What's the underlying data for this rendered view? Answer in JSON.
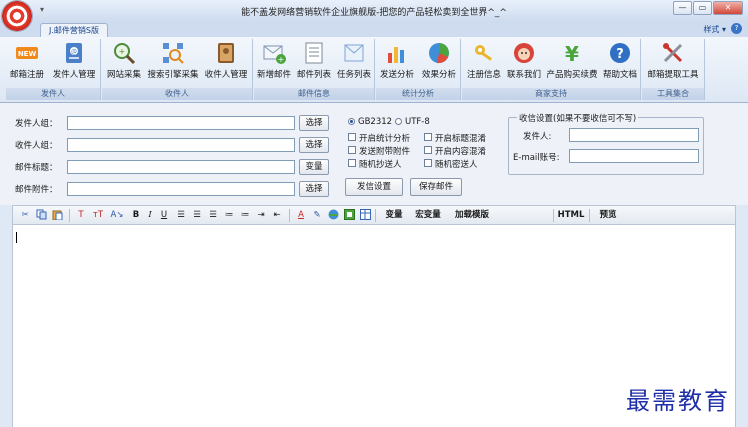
{
  "window": {
    "title": "能不盖发网络营销软件企业旗舰版-把您的产品轻松卖到全世界^_^",
    "quick_access": "▾",
    "controls": {
      "minimize": "—",
      "restore": "▭",
      "close": "✕"
    }
  },
  "tabbar": {
    "active_tab": "J.邮件营销S版",
    "style_menu": "样式 ▾",
    "help": "?"
  },
  "ribbon": {
    "groups": [
      {
        "label": "发件人",
        "buttons": [
          "邮箱注册",
          "发件人管理"
        ]
      },
      {
        "label": "收件人",
        "buttons": [
          "网站采集",
          "搜索引擎采集",
          "收件人管理"
        ]
      },
      {
        "label": "邮件信息",
        "buttons": [
          "新增邮件",
          "邮件列表",
          "任务列表"
        ]
      },
      {
        "label": "统计分析",
        "buttons": [
          "发送分析",
          "效果分析"
        ]
      },
      {
        "label": "商家支持",
        "buttons": [
          "注册信息",
          "联系我们",
          "产品购买续费",
          "帮助文档"
        ]
      },
      {
        "label": "工具集合",
        "buttons": [
          "邮箱提取工具"
        ]
      }
    ],
    "icon_badges": {
      "new": "NEW",
      "yen": "¥",
      "help": "?"
    }
  },
  "form": {
    "labels": {
      "sender_group": "发件人组：",
      "recipient_group": "收件人组：",
      "subject": "邮件标题：",
      "attachment": "邮件附件："
    },
    "values": {
      "sender_group": "",
      "recipient_group": "",
      "subject": "",
      "attachment": ""
    },
    "buttons": {
      "select": "选择",
      "variable": "变量",
      "send_settings": "发信设置",
      "save_mail": "保存邮件"
    },
    "encoding": {
      "selected": "GB2312",
      "options": [
        "GB2312",
        "UTF-8"
      ]
    },
    "options": [
      "开启统计分析",
      "发送附带附件",
      "随机抄送人",
      "开启标题混淆",
      "开启内容混淆",
      "随机密送人"
    ],
    "receive": {
      "legend": "收信设置(如果不要收信可不写)",
      "sender_label": "发件人:",
      "email_label": "E-mail账号:",
      "sender_value": "",
      "email_value": ""
    }
  },
  "editor_toolbar": {
    "variable": "变量",
    "macro": "宏变量",
    "load_template": "加载模版",
    "html": "HTML",
    "preview": "预览",
    "bold": "B",
    "italic": "I",
    "underline": "U",
    "font_color": "A"
  },
  "editor": {
    "content": ""
  },
  "watermark": "最需教育"
}
